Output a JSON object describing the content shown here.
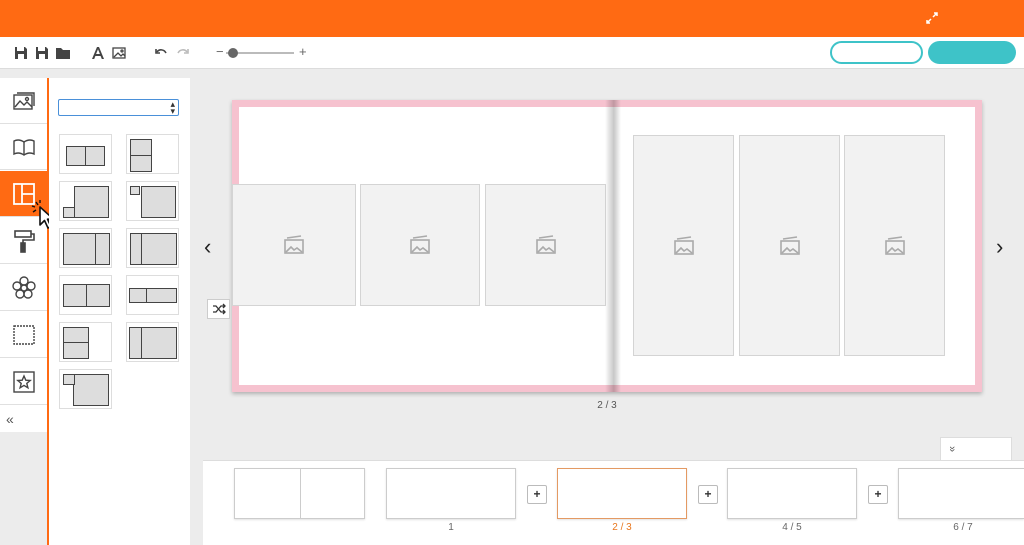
{
  "toolbar": {
    "zoom_minus": "−",
    "zoom_plus": "+",
    "zoom_level": 0.1,
    "button_outline_label": "",
    "button_solid_label": ""
  },
  "sidebar": {
    "collapse": "«",
    "tabs": [
      {
        "icon": "photos-icon",
        "active": false
      },
      {
        "icon": "book-icon",
        "active": false
      },
      {
        "icon": "layout-icon",
        "active": true
      },
      {
        "icon": "paint-roller-icon",
        "active": false
      },
      {
        "icon": "flower-icon",
        "active": false
      },
      {
        "icon": "frame-icon",
        "active": false
      },
      {
        "icon": "star-icon",
        "active": false
      }
    ]
  },
  "layout_panel": {
    "select_value": ""
  },
  "canvas": {
    "page_counter": "2 / 3"
  },
  "strip": {
    "toggle": "»",
    "add_label": "+",
    "pages": [
      {
        "label": "1",
        "active": false
      },
      {
        "label": "2 / 3",
        "active": true
      },
      {
        "label": "4 / 5",
        "active": false
      },
      {
        "label": "6 / 7",
        "active": false
      }
    ]
  },
  "colors": {
    "brand_orange": "#ff6a13",
    "accent_teal": "#3ec3c8",
    "spread_border_pink": "#f6c2cf",
    "active_page_orange": "#e8771f"
  }
}
